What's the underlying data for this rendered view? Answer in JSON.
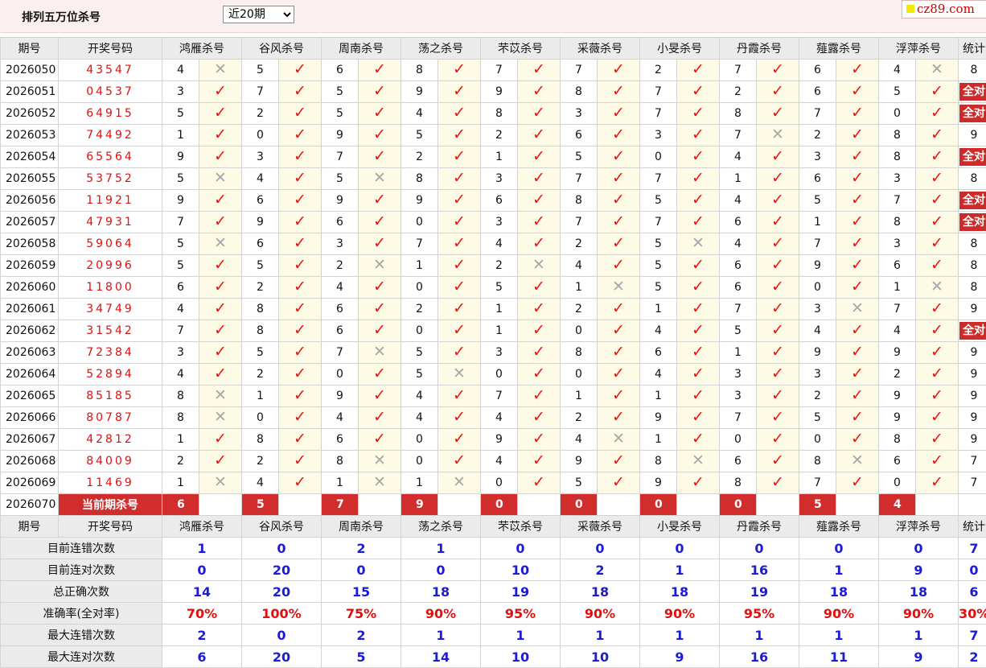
{
  "header": {
    "title": "排列五万位杀号",
    "select_value": "近20期",
    "logo_text": "cz89.com"
  },
  "columns": {
    "issue": "期号",
    "winning": "开奖号码",
    "killers": [
      "鸿雁杀号",
      "谷风杀号",
      "周南杀号",
      "荡之杀号",
      "芣苡杀号",
      "采薇杀号",
      "小旻杀号",
      "丹霞杀号",
      "薤露杀号",
      "浮萍杀号"
    ],
    "stat": "统计"
  },
  "rows": [
    {
      "issue": "2026050",
      "win": "43547",
      "k": [
        "4",
        "5",
        "6",
        "8",
        "7",
        "7",
        "2",
        "7",
        "6",
        "4"
      ],
      "r": [
        "x",
        "v",
        "v",
        "v",
        "v",
        "v",
        "v",
        "v",
        "v",
        "x"
      ],
      "stat": "8"
    },
    {
      "issue": "2026051",
      "win": "04537",
      "k": [
        "3",
        "7",
        "5",
        "9",
        "9",
        "8",
        "7",
        "2",
        "6",
        "5"
      ],
      "r": [
        "v",
        "v",
        "v",
        "v",
        "v",
        "v",
        "v",
        "v",
        "v",
        "v"
      ],
      "stat": "全对"
    },
    {
      "issue": "2026052",
      "win": "64915",
      "k": [
        "5",
        "2",
        "5",
        "4",
        "8",
        "3",
        "7",
        "8",
        "7",
        "0"
      ],
      "r": [
        "v",
        "v",
        "v",
        "v",
        "v",
        "v",
        "v",
        "v",
        "v",
        "v"
      ],
      "stat": "全对"
    },
    {
      "issue": "2026053",
      "win": "74492",
      "k": [
        "1",
        "0",
        "9",
        "5",
        "2",
        "6",
        "3",
        "7",
        "2",
        "8"
      ],
      "r": [
        "v",
        "v",
        "v",
        "v",
        "v",
        "v",
        "v",
        "x",
        "v",
        "v"
      ],
      "stat": "9"
    },
    {
      "issue": "2026054",
      "win": "65564",
      "k": [
        "9",
        "3",
        "7",
        "2",
        "1",
        "5",
        "0",
        "4",
        "3",
        "8"
      ],
      "r": [
        "v",
        "v",
        "v",
        "v",
        "v",
        "v",
        "v",
        "v",
        "v",
        "v"
      ],
      "stat": "全对"
    },
    {
      "issue": "2026055",
      "win": "53752",
      "k": [
        "5",
        "4",
        "5",
        "8",
        "3",
        "7",
        "7",
        "1",
        "6",
        "3"
      ],
      "r": [
        "x",
        "v",
        "x",
        "v",
        "v",
        "v",
        "v",
        "v",
        "v",
        "v"
      ],
      "stat": "8"
    },
    {
      "issue": "2026056",
      "win": "11921",
      "k": [
        "9",
        "6",
        "9",
        "9",
        "6",
        "8",
        "5",
        "4",
        "5",
        "7"
      ],
      "r": [
        "v",
        "v",
        "v",
        "v",
        "v",
        "v",
        "v",
        "v",
        "v",
        "v"
      ],
      "stat": "全对"
    },
    {
      "issue": "2026057",
      "win": "47931",
      "k": [
        "7",
        "9",
        "6",
        "0",
        "3",
        "7",
        "7",
        "6",
        "1",
        "8"
      ],
      "r": [
        "v",
        "v",
        "v",
        "v",
        "v",
        "v",
        "v",
        "v",
        "v",
        "v"
      ],
      "stat": "全对"
    },
    {
      "issue": "2026058",
      "win": "59064",
      "k": [
        "5",
        "6",
        "3",
        "7",
        "4",
        "2",
        "5",
        "4",
        "7",
        "3"
      ],
      "r": [
        "x",
        "v",
        "v",
        "v",
        "v",
        "v",
        "x",
        "v",
        "v",
        "v"
      ],
      "stat": "8"
    },
    {
      "issue": "2026059",
      "win": "20996",
      "k": [
        "5",
        "5",
        "2",
        "1",
        "2",
        "4",
        "5",
        "6",
        "9",
        "6"
      ],
      "r": [
        "v",
        "v",
        "x",
        "v",
        "x",
        "v",
        "v",
        "v",
        "v",
        "v"
      ],
      "stat": "8"
    },
    {
      "issue": "2026060",
      "win": "11800",
      "k": [
        "6",
        "2",
        "4",
        "0",
        "5",
        "1",
        "5",
        "6",
        "0",
        "1"
      ],
      "r": [
        "v",
        "v",
        "v",
        "v",
        "v",
        "x",
        "v",
        "v",
        "v",
        "x"
      ],
      "stat": "8"
    },
    {
      "issue": "2026061",
      "win": "34749",
      "k": [
        "4",
        "8",
        "6",
        "2",
        "1",
        "2",
        "1",
        "7",
        "3",
        "7"
      ],
      "r": [
        "v",
        "v",
        "v",
        "v",
        "v",
        "v",
        "v",
        "v",
        "x",
        "v"
      ],
      "stat": "9"
    },
    {
      "issue": "2026062",
      "win": "31542",
      "k": [
        "7",
        "8",
        "6",
        "0",
        "1",
        "0",
        "4",
        "5",
        "4",
        "4"
      ],
      "r": [
        "v",
        "v",
        "v",
        "v",
        "v",
        "v",
        "v",
        "v",
        "v",
        "v"
      ],
      "stat": "全对"
    },
    {
      "issue": "2026063",
      "win": "72384",
      "k": [
        "3",
        "5",
        "7",
        "5",
        "3",
        "8",
        "6",
        "1",
        "9",
        "9"
      ],
      "r": [
        "v",
        "v",
        "x",
        "v",
        "v",
        "v",
        "v",
        "v",
        "v",
        "v"
      ],
      "stat": "9"
    },
    {
      "issue": "2026064",
      "win": "52894",
      "k": [
        "4",
        "2",
        "0",
        "5",
        "0",
        "0",
        "4",
        "3",
        "3",
        "2"
      ],
      "r": [
        "v",
        "v",
        "v",
        "x",
        "v",
        "v",
        "v",
        "v",
        "v",
        "v"
      ],
      "stat": "9"
    },
    {
      "issue": "2026065",
      "win": "85185",
      "k": [
        "8",
        "1",
        "9",
        "4",
        "7",
        "1",
        "1",
        "3",
        "2",
        "9"
      ],
      "r": [
        "x",
        "v",
        "v",
        "v",
        "v",
        "v",
        "v",
        "v",
        "v",
        "v"
      ],
      "stat": "9"
    },
    {
      "issue": "2026066",
      "win": "80787",
      "k": [
        "8",
        "0",
        "4",
        "4",
        "4",
        "2",
        "9",
        "7",
        "5",
        "9"
      ],
      "r": [
        "x",
        "v",
        "v",
        "v",
        "v",
        "v",
        "v",
        "v",
        "v",
        "v"
      ],
      "stat": "9"
    },
    {
      "issue": "2026067",
      "win": "42812",
      "k": [
        "1",
        "8",
        "6",
        "0",
        "9",
        "4",
        "1",
        "0",
        "0",
        "8"
      ],
      "r": [
        "v",
        "v",
        "v",
        "v",
        "v",
        "x",
        "v",
        "v",
        "v",
        "v"
      ],
      "stat": "9"
    },
    {
      "issue": "2026068",
      "win": "84009",
      "k": [
        "2",
        "2",
        "8",
        "0",
        "4",
        "9",
        "8",
        "6",
        "8",
        "6"
      ],
      "r": [
        "v",
        "v",
        "x",
        "v",
        "v",
        "v",
        "x",
        "v",
        "x",
        "v"
      ],
      "stat": "7"
    },
    {
      "issue": "2026069",
      "win": "11469",
      "k": [
        "1",
        "4",
        "1",
        "1",
        "0",
        "5",
        "9",
        "8",
        "7",
        "0"
      ],
      "r": [
        "x",
        "v",
        "x",
        "x",
        "v",
        "v",
        "v",
        "v",
        "v",
        "v"
      ],
      "stat": "7"
    }
  ],
  "current": {
    "issue": "2026070",
    "label": "当前期杀号",
    "k": [
      "6",
      "5",
      "7",
      "9",
      "0",
      "0",
      "0",
      "0",
      "5",
      "4"
    ]
  },
  "summary": [
    {
      "label": "目前连错次数",
      "vals": [
        "1",
        "0",
        "2",
        "1",
        "0",
        "0",
        "0",
        "0",
        "0",
        "0"
      ],
      "stat": "7",
      "pct": false
    },
    {
      "label": "目前连对次数",
      "vals": [
        "0",
        "20",
        "0",
        "0",
        "10",
        "2",
        "1",
        "16",
        "1",
        "9"
      ],
      "stat": "0",
      "pct": false
    },
    {
      "label": "总正确次数",
      "vals": [
        "14",
        "20",
        "15",
        "18",
        "19",
        "18",
        "18",
        "19",
        "18",
        "18"
      ],
      "stat": "6",
      "pct": false
    },
    {
      "label": "准确率(全对率)",
      "vals": [
        "70%",
        "100%",
        "75%",
        "90%",
        "95%",
        "90%",
        "90%",
        "95%",
        "90%",
        "90%"
      ],
      "stat": "30%",
      "pct": true
    },
    {
      "label": "最大连错次数",
      "vals": [
        "2",
        "0",
        "2",
        "1",
        "1",
        "1",
        "1",
        "1",
        "1",
        "1"
      ],
      "stat": "7",
      "pct": false
    },
    {
      "label": "最大连对次数",
      "vals": [
        "6",
        "20",
        "5",
        "14",
        "10",
        "10",
        "9",
        "16",
        "11",
        "9"
      ],
      "stat": "2",
      "pct": false
    }
  ],
  "icons": {
    "correct": "check-icon",
    "wrong": "cross-icon"
  },
  "colors": {
    "accent": "#d22d2d",
    "win_text": "#e01010",
    "stat_blue": "#1c1cd6",
    "mark_bg": "#fdfbe6",
    "header_bg": "#ebebeb"
  }
}
